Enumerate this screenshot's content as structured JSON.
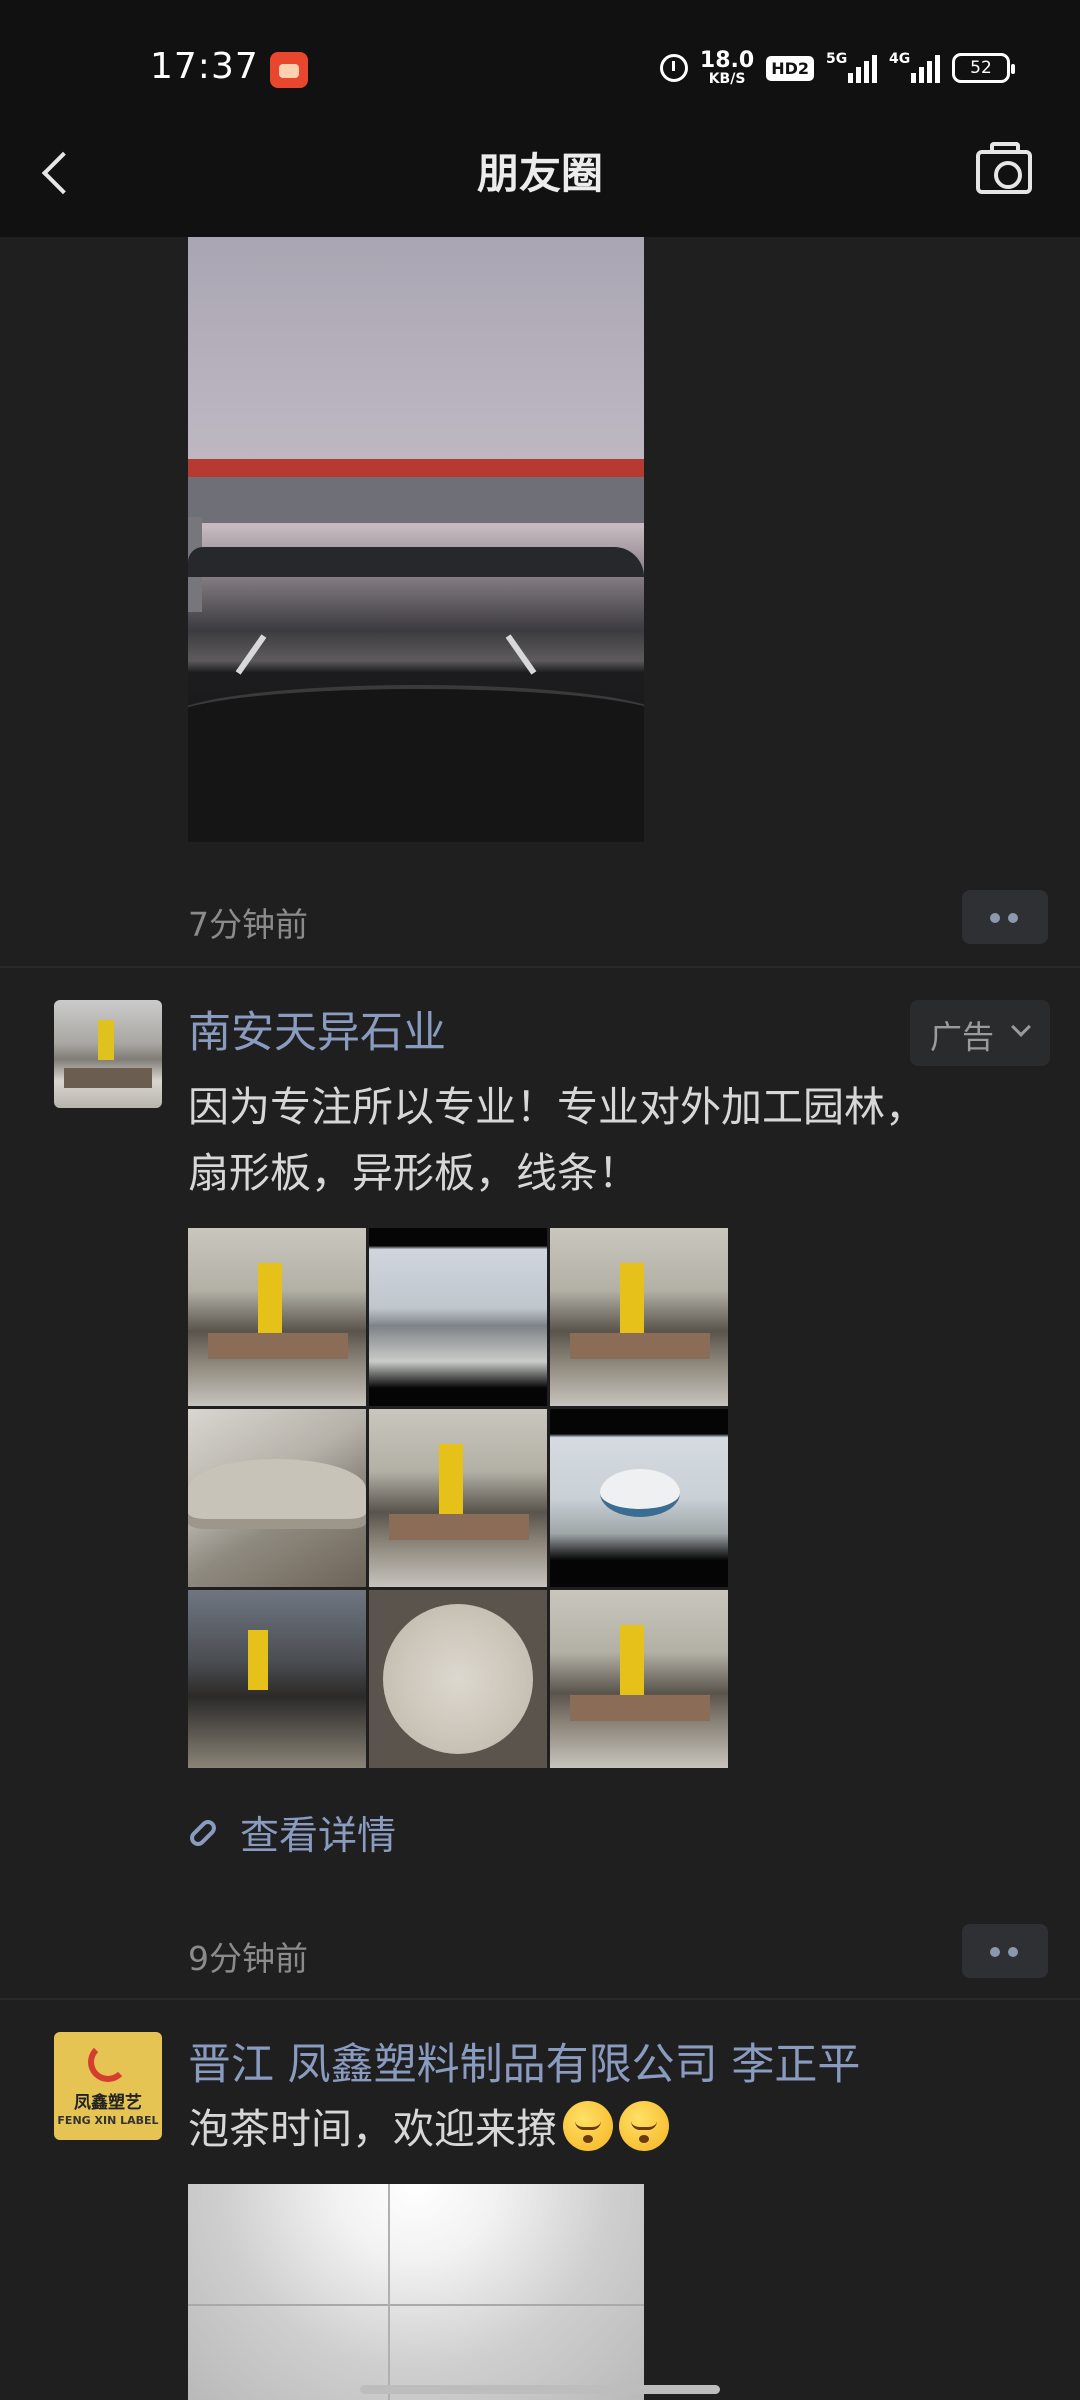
{
  "status_bar": {
    "time": "17:37",
    "net_speed_value": "18.0",
    "net_speed_unit": "KB/S",
    "hd_badge": "HD2",
    "sim1_label": "5G",
    "sim2_label": "4G",
    "battery": "52"
  },
  "nav": {
    "title": "朋友圈"
  },
  "posts": [
    {
      "time_ago": "7分钟前"
    },
    {
      "name": "南安天异石业",
      "ad_label": "广告",
      "text_line1": "因为专注所以专业！专业对外加工园林，",
      "text_line2": "扇形板，异形板，线条！",
      "link_label": "查看详情",
      "time_ago": "9分钟前"
    },
    {
      "name": "晋江 凤鑫塑料制品有限公司 李正平",
      "text": "泡茶时间，欢迎来撩",
      "avatar_text_cn": "凤鑫塑艺",
      "avatar_text_en": "FENG XIN LABEL"
    }
  ],
  "colors": {
    "background": "#1f1f1f",
    "name_link": "#8a9bc0",
    "bar": "#111111"
  }
}
